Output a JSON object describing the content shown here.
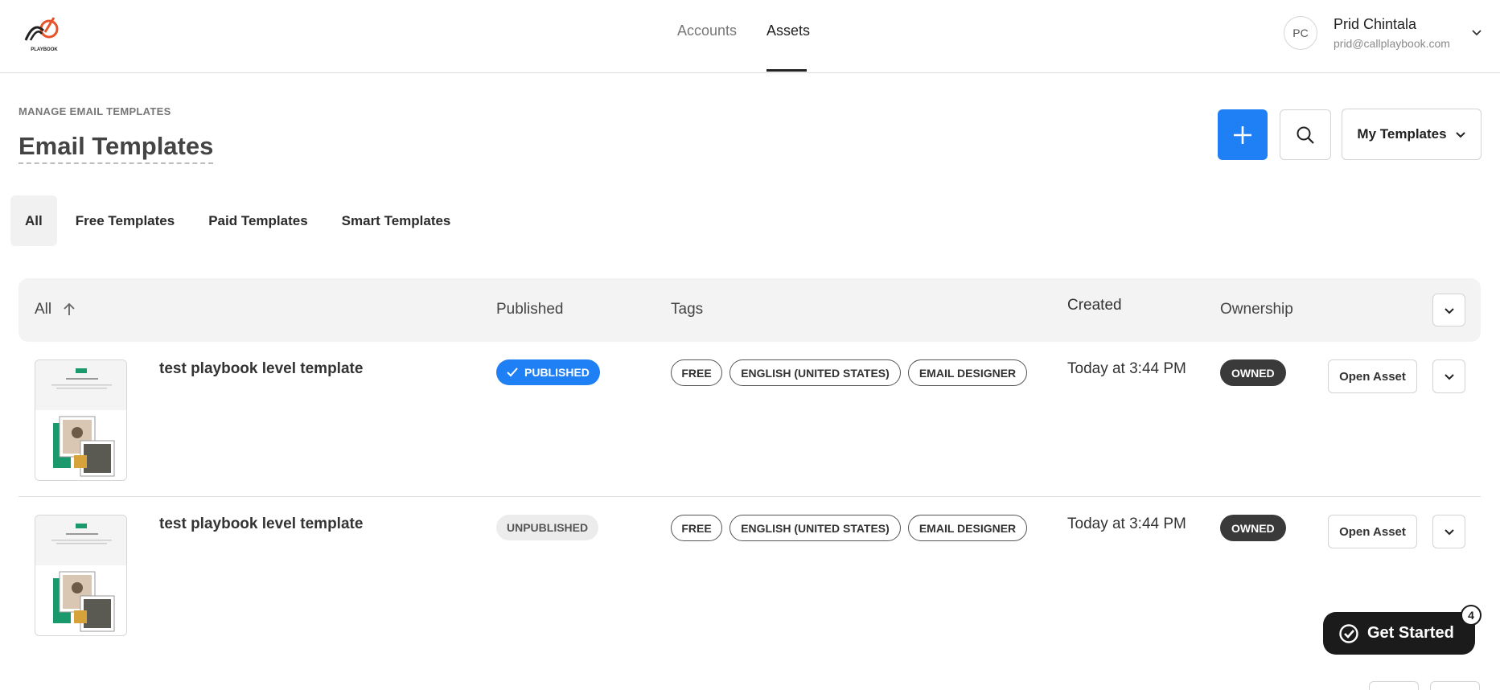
{
  "brand": {
    "logo_text": "PLAYBOOK",
    "logo_color": "#e8542a"
  },
  "nav": {
    "items": [
      {
        "label": "Accounts"
      },
      {
        "label": "Assets"
      }
    ],
    "active": "Assets"
  },
  "user": {
    "initials": "PC",
    "name": "Prid Chintala",
    "email": "prid@callplaybook.com"
  },
  "page": {
    "eyebrow": "MANAGE EMAIL TEMPLATES",
    "title": "Email Templates"
  },
  "toolbar": {
    "add_icon": "plus-icon",
    "search_icon": "search-icon",
    "filter_label": "My Templates"
  },
  "tabs": [
    {
      "label": "All",
      "active": true
    },
    {
      "label": "Free Templates"
    },
    {
      "label": "Paid Templates"
    },
    {
      "label": "Smart Templates"
    }
  ],
  "table": {
    "columns": {
      "name": "All",
      "published": "Published",
      "tags": "Tags",
      "created": "Created",
      "ownership": "Ownership"
    },
    "rows": [
      {
        "title": "test playbook level template",
        "status": "PUBLISHED",
        "tags": [
          "FREE",
          "ENGLISH (UNITED STATES)",
          "EMAIL DESIGNER"
        ],
        "created": "Today at 3:44 PM",
        "ownership": "OWNED",
        "action": "Open Asset"
      },
      {
        "title": "test playbook level template",
        "status": "UNPUBLISHED",
        "tags": [
          "FREE",
          "ENGLISH (UNITED STATES)",
          "EMAIL DESIGNER"
        ],
        "created": "Today at 3:44 PM",
        "ownership": "OWNED",
        "action": "Open Asset"
      }
    ]
  },
  "get_started": {
    "label": "Get Started",
    "badge": "4"
  },
  "colors": {
    "primary": "#1f7ff5",
    "dark": "#1b1b1b",
    "owned": "#3a3a3a",
    "thumb_accent": "#1a9a6c"
  }
}
